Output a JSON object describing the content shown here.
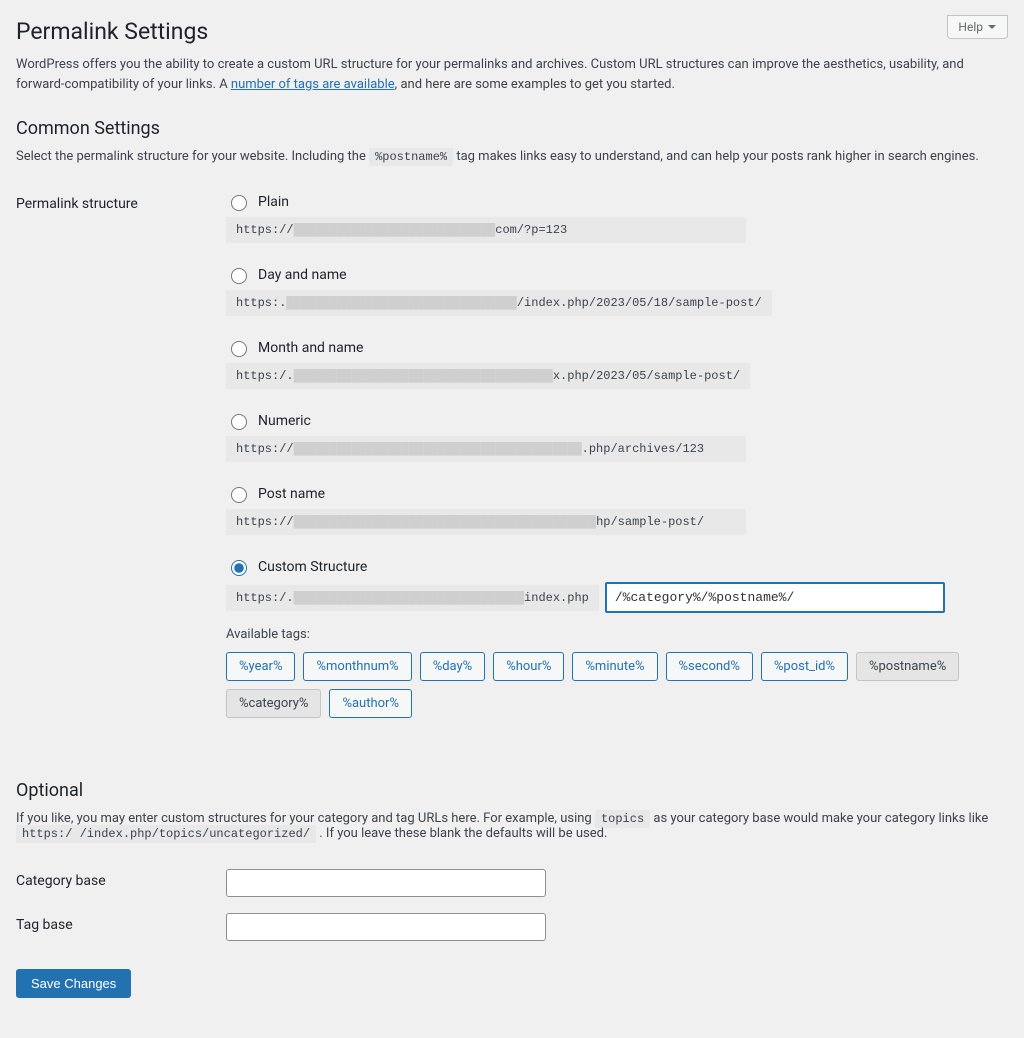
{
  "help_label": "Help",
  "page_title": "Permalink Settings",
  "intro_text_1": "WordPress offers you the ability to create a custom URL structure for your permalinks and archives. Custom URL structures can improve the aesthetics, usability, and forward-compatibility of your links. A ",
  "intro_link": "number of tags are available",
  "intro_text_2": ", and here are some examples to get you started.",
  "common_heading": "Common Settings",
  "common_desc_1": "Select the permalink structure for your website. Including the ",
  "common_tag": "%postname%",
  "common_desc_2": " tag makes links easy to understand, and can help your posts rank higher in search engines.",
  "structure_label": "Permalink structure",
  "options": {
    "plain": {
      "label": "Plain",
      "prefix": "https://",
      "suffix": "com/?p=123"
    },
    "dayname": {
      "label": "Day and name",
      "prefix": "https:.",
      "suffix": "/index.php/2023/05/18/sample-post/"
    },
    "monthname": {
      "label": "Month and name",
      "prefix": "https:/.",
      "suffix": "x.php/2023/05/sample-post/"
    },
    "numeric": {
      "label": "Numeric",
      "prefix": "https://",
      "suffix": ".php/archives/123"
    },
    "postname": {
      "label": "Post name",
      "prefix": "https://",
      "suffix": "hp/sample-post/"
    },
    "custom": {
      "label": "Custom Structure",
      "prefix": "https:/.",
      "prefix_suffix": "index.php",
      "value": "/%category%/%postname%/"
    }
  },
  "available_label": "Available tags:",
  "tags": [
    "%year%",
    "%monthnum%",
    "%day%",
    "%hour%",
    "%minute%",
    "%second%",
    "%post_id%",
    "%postname%",
    "%category%",
    "%author%"
  ],
  "optional_heading": "Optional",
  "optional_desc_1": "If you like, you may enter custom structures for your category and tag URLs here. For example, using ",
  "optional_code_1": "topics",
  "optional_desc_2": " as your category base would make your category links like ",
  "optional_code_2": "https:/                                             /index.php/topics/uncategorized/",
  "optional_desc_3": " . If you leave these blank the defaults will be used.",
  "category_base_label": "Category base",
  "tag_base_label": "Tag base",
  "save_label": "Save Changes"
}
